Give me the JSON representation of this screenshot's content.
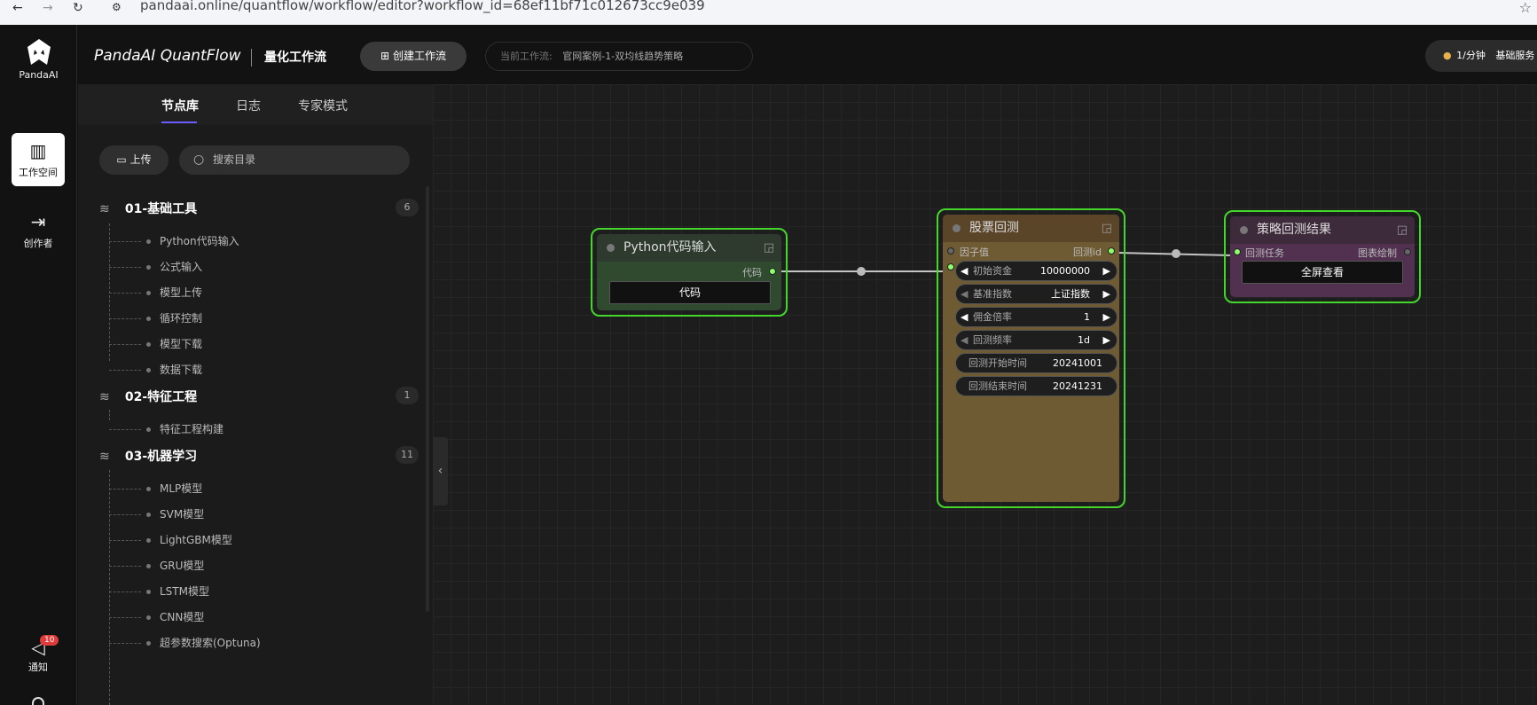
{
  "browser": {
    "back": "←",
    "forward": "→",
    "reload": "↻",
    "site_icon": "⚙",
    "url": "pandaai.online/quantflow/workflow/editor?workflow_id=68ef11bf71c012673cc9e039",
    "star": "☆"
  },
  "rail": {
    "logo_text": "PandaAI",
    "items": [
      {
        "label": "工作空间",
        "icon": "layout-icon",
        "glyph": "▥"
      },
      {
        "label": "创作者",
        "icon": "exit-icon",
        "glyph": "⇥"
      }
    ],
    "notify": {
      "label": "通知",
      "glyph": "◁",
      "badge": "10"
    }
  },
  "header": {
    "brand": "PandaAI QuantFlow",
    "subtitle": "量化工作流",
    "create_label": "创建工作流",
    "create_glyph": "⊞",
    "current_key": "当前工作流:",
    "current_value": "官网案例-1-双均线趋势策略",
    "rate_coin": "●",
    "rate_value": "1/分钟",
    "rate_plan": "基础服务"
  },
  "panel": {
    "tabs": [
      "节点库",
      "日志",
      "专家模式"
    ],
    "upload_label": "上传",
    "upload_glyph": "▭",
    "search_glyph": "○",
    "search_placeholder": "搜索目录",
    "layers_glyph": "≋",
    "collapse_glyph": "‹",
    "categories": [
      {
        "name": "01-基础工具",
        "count": "6",
        "items": [
          "Python代码输入",
          "公式输入",
          "模型上传",
          "循环控制",
          "模型下载",
          "数据下载"
        ]
      },
      {
        "name": "02-特征工程",
        "count": "1",
        "items": [
          "特征工程构建"
        ]
      },
      {
        "name": "03-机器学习",
        "count": "11",
        "items": [
          "MLP模型",
          "SVM模型",
          "LightGBM模型",
          "GRU模型",
          "LSTM模型",
          "CNN模型",
          "超参数搜索(Optuna)"
        ]
      }
    ]
  },
  "nodes": {
    "edit_glyph": "◲",
    "python": {
      "title": "Python代码输入",
      "output": "代码",
      "button": "代码"
    },
    "backtest": {
      "title": "股票回测",
      "input": "因子值",
      "output": "回测id",
      "widgets": [
        {
          "key": "初始资金",
          "value": "10000000"
        },
        {
          "key": "基准指数",
          "value": "上证指数"
        },
        {
          "key": "佣金倍率",
          "value": "1"
        },
        {
          "key": "回测频率",
          "value": "1d"
        }
      ],
      "text_widgets": [
        {
          "key": "回测开始时间",
          "value": "20241001"
        },
        {
          "key": "回测结束时间",
          "value": "20241231"
        }
      ],
      "arrow_left": "◀",
      "arrow_right": "▶"
    },
    "result": {
      "title": "策略回测结果",
      "input": "回测任务",
      "output": "图表绘制",
      "button": "全屏查看"
    }
  },
  "colors": {
    "node_border": "#44d62c",
    "python_bg": "#2f4a2f",
    "python_title": "#2d3a2d",
    "backtest_bg": "#6e5b33",
    "backtest_title": "#5a4529",
    "result_bg": "#51314f",
    "result_title": "#3d2a3b"
  }
}
